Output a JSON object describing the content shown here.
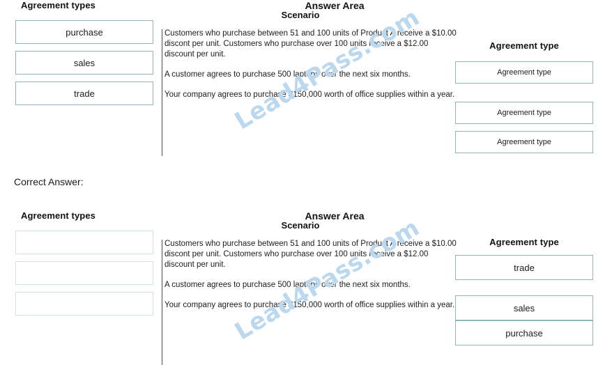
{
  "correct_answer_label": "Correct Answer:",
  "watermark": "Lead4Pass.com",
  "colors": {
    "box_border": "#8fb5bb",
    "empty_box_border": "#cfe3e6",
    "divider": "#4a4a4a",
    "watermark": "#bcd8ef",
    "text": "#1c1c1c"
  },
  "question": {
    "left_heading": "Agreement types",
    "answer_area_title": "Answer Area",
    "scenario_heading": "Scenario",
    "agreement_type_heading": "Agreement type",
    "tiles": [
      {
        "label": "purchase"
      },
      {
        "label": "sales"
      },
      {
        "label": "trade"
      }
    ],
    "scenarios": [
      {
        "text": "Customers who purchase between 51 and 100 units of Product A receive a $10.00 discont per unit. Customers who purchase over 100 units receive a $12.00 discount per unit."
      },
      {
        "text": "A customer agrees to purchase 500 laptops over the next six months."
      },
      {
        "text": "Your company agrees to purchase $150,000 worth of office supplies within a year."
      }
    ],
    "slots": [
      {
        "value": "Agreement type"
      },
      {
        "value": "Agreement type"
      },
      {
        "value": "Agreement type"
      }
    ]
  },
  "answer": {
    "left_heading": "Agreement types",
    "answer_area_title": "Answer Area",
    "scenario_heading": "Scenario",
    "agreement_type_heading": "Agreement type",
    "tiles": [
      {
        "label": ""
      },
      {
        "label": ""
      },
      {
        "label": ""
      }
    ],
    "scenarios": [
      {
        "text": "Customers who purchase between 51 and 100 units of Product A receive a $10.00 discont per unit. Customers who purchase over 100 units receive a $12.00 discount per unit."
      },
      {
        "text": "A customer agrees to purchase 500 laptops over the next six months."
      },
      {
        "text": "Your company agrees to purchase $150,000 worth of office supplies within a year."
      }
    ],
    "slots": [
      {
        "value": "trade"
      },
      {
        "value": "sales"
      },
      {
        "value": "purchase"
      }
    ]
  }
}
